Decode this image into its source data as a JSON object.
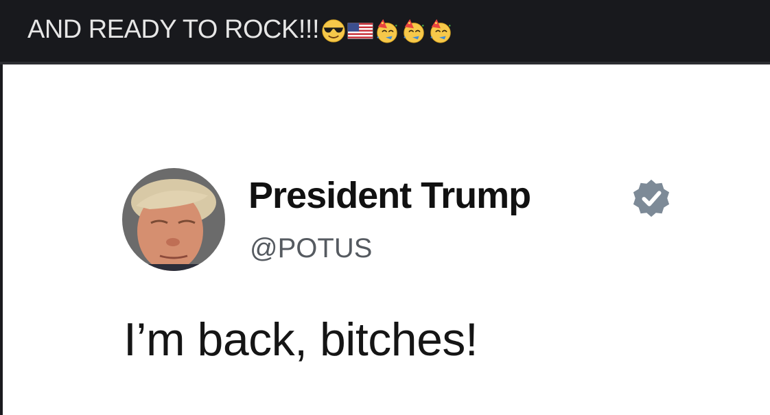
{
  "post": {
    "caption": "AND READY TO ROCK!!!",
    "emojis": [
      "cool-face-icon",
      "us-flag-icon",
      "party-face-icon",
      "party-face-icon",
      "party-face-icon"
    ]
  },
  "tweet": {
    "display_name": "President Trump",
    "handle": "@POTUS",
    "text": "I’m back, bitches!",
    "verified": true
  },
  "colors": {
    "header_bg": "#18191d",
    "caption_text": "#e6e6e6",
    "image_bg": "#ffffff",
    "verified_badge": "#7d8a97"
  }
}
